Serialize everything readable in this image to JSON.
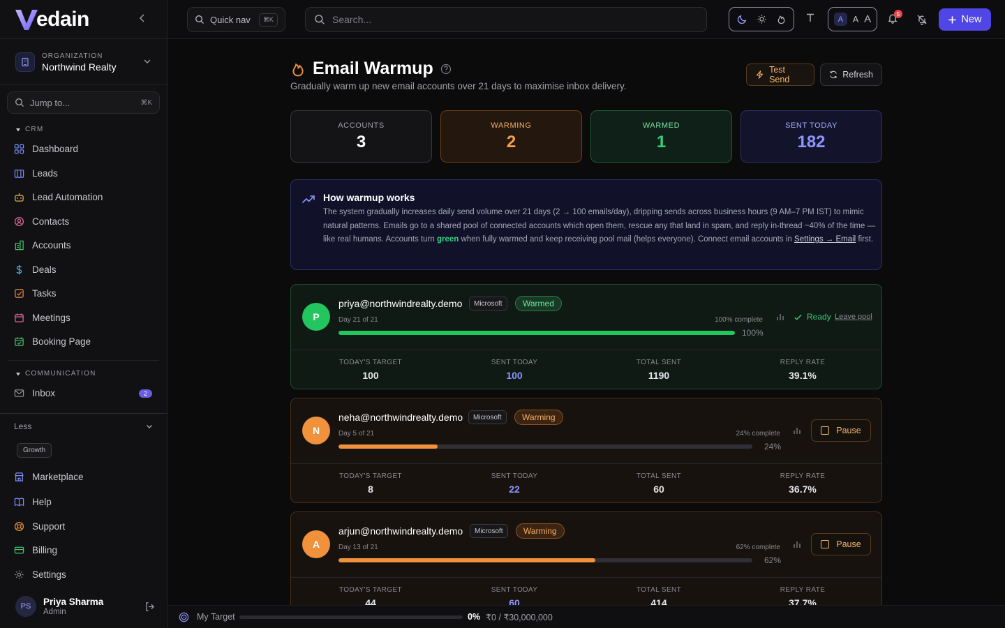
{
  "app": {
    "name": "edain",
    "logo_letter": "V"
  },
  "org": {
    "label": "ORGANIZATION",
    "name": "Northwind Realty"
  },
  "jump": {
    "placeholder": "Jump to...",
    "shortcut": "⌘K"
  },
  "sidebar": {
    "crm_label": "CRM",
    "crm_items": [
      {
        "label": "Dashboard",
        "icon": "grid-icon"
      },
      {
        "label": "Leads",
        "icon": "building-icon"
      },
      {
        "label": "Lead Automation",
        "icon": "bot-icon"
      },
      {
        "label": "Contacts",
        "icon": "contact-icon"
      },
      {
        "label": "Accounts",
        "icon": "accounts-icon"
      },
      {
        "label": "Deals",
        "icon": "dollar-icon"
      },
      {
        "label": "Tasks",
        "icon": "task-icon"
      },
      {
        "label": "Meetings",
        "icon": "calendar-icon"
      },
      {
        "label": "Booking Page",
        "icon": "calendar-check-icon"
      }
    ],
    "comm_label": "COMMUNICATION",
    "inbox_label": "Inbox",
    "inbox_count": "2",
    "less_label": "Less",
    "growth_label": "Growth",
    "bottom_items": [
      {
        "label": "Marketplace",
        "icon": "store-icon"
      },
      {
        "label": "Help",
        "icon": "book-icon"
      },
      {
        "label": "Support",
        "icon": "lifebuoy-icon"
      },
      {
        "label": "Billing",
        "icon": "card-icon"
      },
      {
        "label": "Settings",
        "icon": "gear-icon"
      }
    ]
  },
  "user": {
    "initials": "PS",
    "name": "Priya Sharma",
    "role": "Admin"
  },
  "topbar": {
    "quicknav_label": "Quick nav",
    "quicknav_shortcut": "⌘K",
    "search_placeholder": "Search...",
    "font_sizes": [
      "A",
      "A",
      "A"
    ],
    "notif_count": "5",
    "new_label": "New"
  },
  "page": {
    "title": "Email Warmup",
    "subtitle": "Gradually warm up new email accounts over 21 days to maximise inbox delivery.",
    "test_send_label": "Test Send",
    "refresh_label": "Refresh"
  },
  "stats": [
    {
      "label": "ACCOUNTS",
      "value": "3"
    },
    {
      "label": "WARMING",
      "value": "2"
    },
    {
      "label": "WARMED",
      "value": "1"
    },
    {
      "label": "SENT TODAY",
      "value": "182"
    }
  ],
  "info": {
    "title": "How warmup works",
    "text_before": "The system gradually increases daily send volume over 21 days (2 → 100 emails/day), dripping sends across business hours (9 AM–7 PM IST) to mimic natural patterns. Emails go to a shared pool of connected accounts which open them, rescue any that land in spam, and reply in-thread ~40% of the time — like real humans. Accounts turn ",
    "text_green": "green",
    "text_after": " when fully warmed and keep receiving pool mail (helps everyone). Connect email accounts in ",
    "link": "Settings → Email",
    "text_end": " first."
  },
  "accounts": [
    {
      "initial": "P",
      "email": "priya@northwindrealty.demo",
      "provider": "Microsoft",
      "status": "Warmed",
      "day": "Day 21 of 21",
      "complete": "100% complete",
      "pct": "100%",
      "progress": 1.0,
      "ready_label": "Ready",
      "leave_label": "Leave pool",
      "target_k": "TODAY'S TARGET",
      "target": "100",
      "sent_k": "SENT TODAY",
      "sent": "100",
      "total_k": "TOTAL SENT",
      "total": "1190",
      "reply_k": "REPLY RATE",
      "reply": "39.1%"
    },
    {
      "initial": "N",
      "email": "neha@northwindrealty.demo",
      "provider": "Microsoft",
      "status": "Warming",
      "day": "Day 5 of 21",
      "complete": "24% complete",
      "pct": "24%",
      "progress": 0.24,
      "pause_label": "Pause",
      "target_k": "TODAY'S TARGET",
      "target": "8",
      "sent_k": "SENT TODAY",
      "sent": "22",
      "total_k": "TOTAL SENT",
      "total": "60",
      "reply_k": "REPLY RATE",
      "reply": "36.7%"
    },
    {
      "initial": "A",
      "email": "arjun@northwindrealty.demo",
      "provider": "Microsoft",
      "status": "Warming",
      "day": "Day 13 of 21",
      "complete": "62% complete",
      "pct": "62%",
      "progress": 0.62,
      "pause_label": "Pause",
      "target_k": "TODAY'S TARGET",
      "target": "44",
      "sent_k": "SENT TODAY",
      "sent": "60",
      "total_k": "TOTAL SENT",
      "total": "414",
      "reply_k": "REPLY RATE",
      "reply": "37.7%"
    }
  ],
  "bottom": {
    "label": "My Target",
    "pct": "0%",
    "progress": 0,
    "amount": "₹0 / ₹30,000,000"
  },
  "colors": {
    "accent": "#4f46e5",
    "warming": "#f0913b",
    "warmed": "#22c55e",
    "blue": "#8d95ff"
  }
}
